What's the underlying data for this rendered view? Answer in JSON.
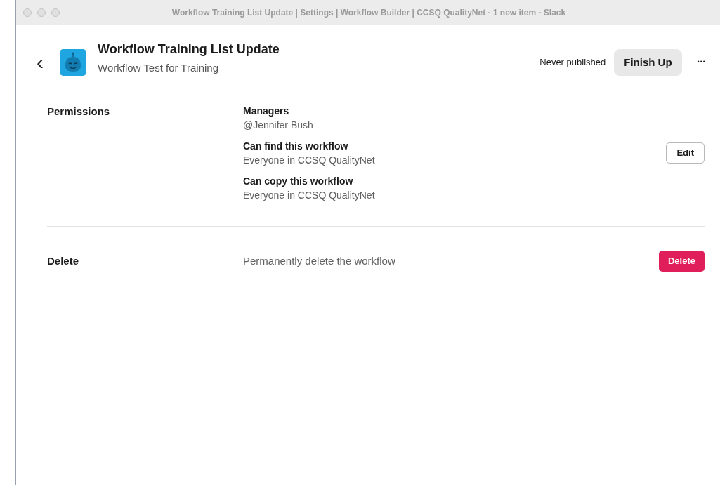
{
  "window": {
    "title": "Workflow Training List Update | Settings | Workflow Builder | CCSQ QualityNet - 1 new item - Slack"
  },
  "header": {
    "back": "‹",
    "title": "Workflow Training List Update",
    "subtitle": "Workflow Test for Training",
    "status": "Never published",
    "primary_button": "Finish Up",
    "more": "•••"
  },
  "sections": [
    {
      "kind": "permissions",
      "label": "Permissions",
      "entries": [
        {
          "heading": "Managers",
          "value": "@Jennifer Bush"
        },
        {
          "heading": "Can find this workflow",
          "value": "Everyone in CCSQ QualityNet"
        },
        {
          "heading": "Can copy this workflow",
          "value": "Everyone in CCSQ QualityNet"
        }
      ],
      "button": "Edit"
    },
    {
      "kind": "delete",
      "label": "Delete",
      "description": "Permanently delete the workflow",
      "button": "Delete"
    }
  ]
}
